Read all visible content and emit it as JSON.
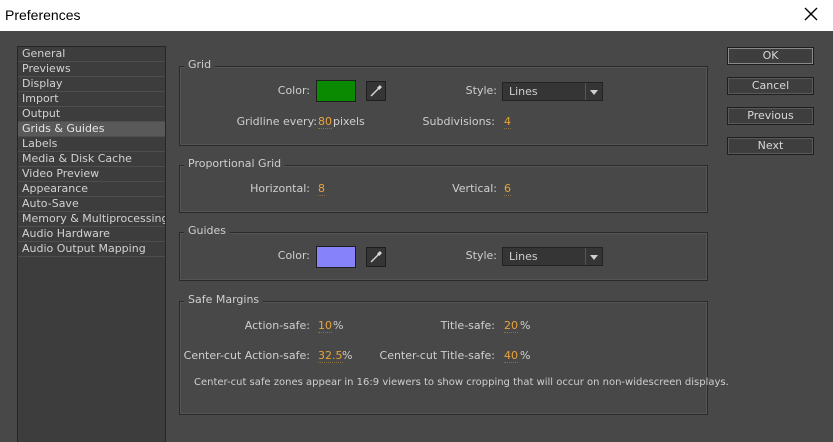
{
  "window": {
    "title": "Preferences"
  },
  "sidebar": {
    "items": [
      {
        "label": "General"
      },
      {
        "label": "Previews"
      },
      {
        "label": "Display"
      },
      {
        "label": "Import"
      },
      {
        "label": "Output"
      },
      {
        "label": "Grids & Guides",
        "selected": true
      },
      {
        "label": "Labels"
      },
      {
        "label": "Media & Disk Cache"
      },
      {
        "label": "Video Preview"
      },
      {
        "label": "Appearance"
      },
      {
        "label": "Auto-Save"
      },
      {
        "label": "Memory & Multiprocessing"
      },
      {
        "label": "Audio Hardware"
      },
      {
        "label": "Audio Output Mapping"
      }
    ]
  },
  "grid": {
    "legend": "Grid",
    "color_label": "Color:",
    "color_value": "#0a8a00",
    "style_label": "Style:",
    "style_value": "Lines",
    "gridline_label": "Gridline every:",
    "gridline_value": "80",
    "gridline_unit": "pixels",
    "subdivisions_label": "Subdivisions:",
    "subdivisions_value": "4"
  },
  "proportional_grid": {
    "legend": "Proportional Grid",
    "horizontal_label": "Horizontal:",
    "horizontal_value": "8",
    "vertical_label": "Vertical:",
    "vertical_value": "6"
  },
  "guides": {
    "legend": "Guides",
    "color_label": "Color:",
    "color_value": "#8582fa",
    "style_label": "Style:",
    "style_value": "Lines"
  },
  "safe_margins": {
    "legend": "Safe Margins",
    "action_safe_label": "Action-safe:",
    "action_safe_value": "10",
    "title_safe_label": "Title-safe:",
    "title_safe_value": "20",
    "cc_action_label": "Center-cut Action-safe:",
    "cc_action_value": "32.5",
    "cc_title_label": "Center-cut Title-safe:",
    "cc_title_value": "40",
    "percent": "%",
    "note": "Center-cut safe zones appear in 16:9 viewers to show cropping that will occur on non-widescreen displays."
  },
  "buttons": {
    "ok": "OK",
    "cancel": "Cancel",
    "previous": "Previous",
    "next": "Next"
  },
  "colors": {
    "accent_value": "#e8a33a",
    "panel_bg": "#484848"
  },
  "icons": {
    "close": "close-icon",
    "eyedropper": "eyedropper-icon",
    "dropdown": "chevron-down-icon"
  }
}
